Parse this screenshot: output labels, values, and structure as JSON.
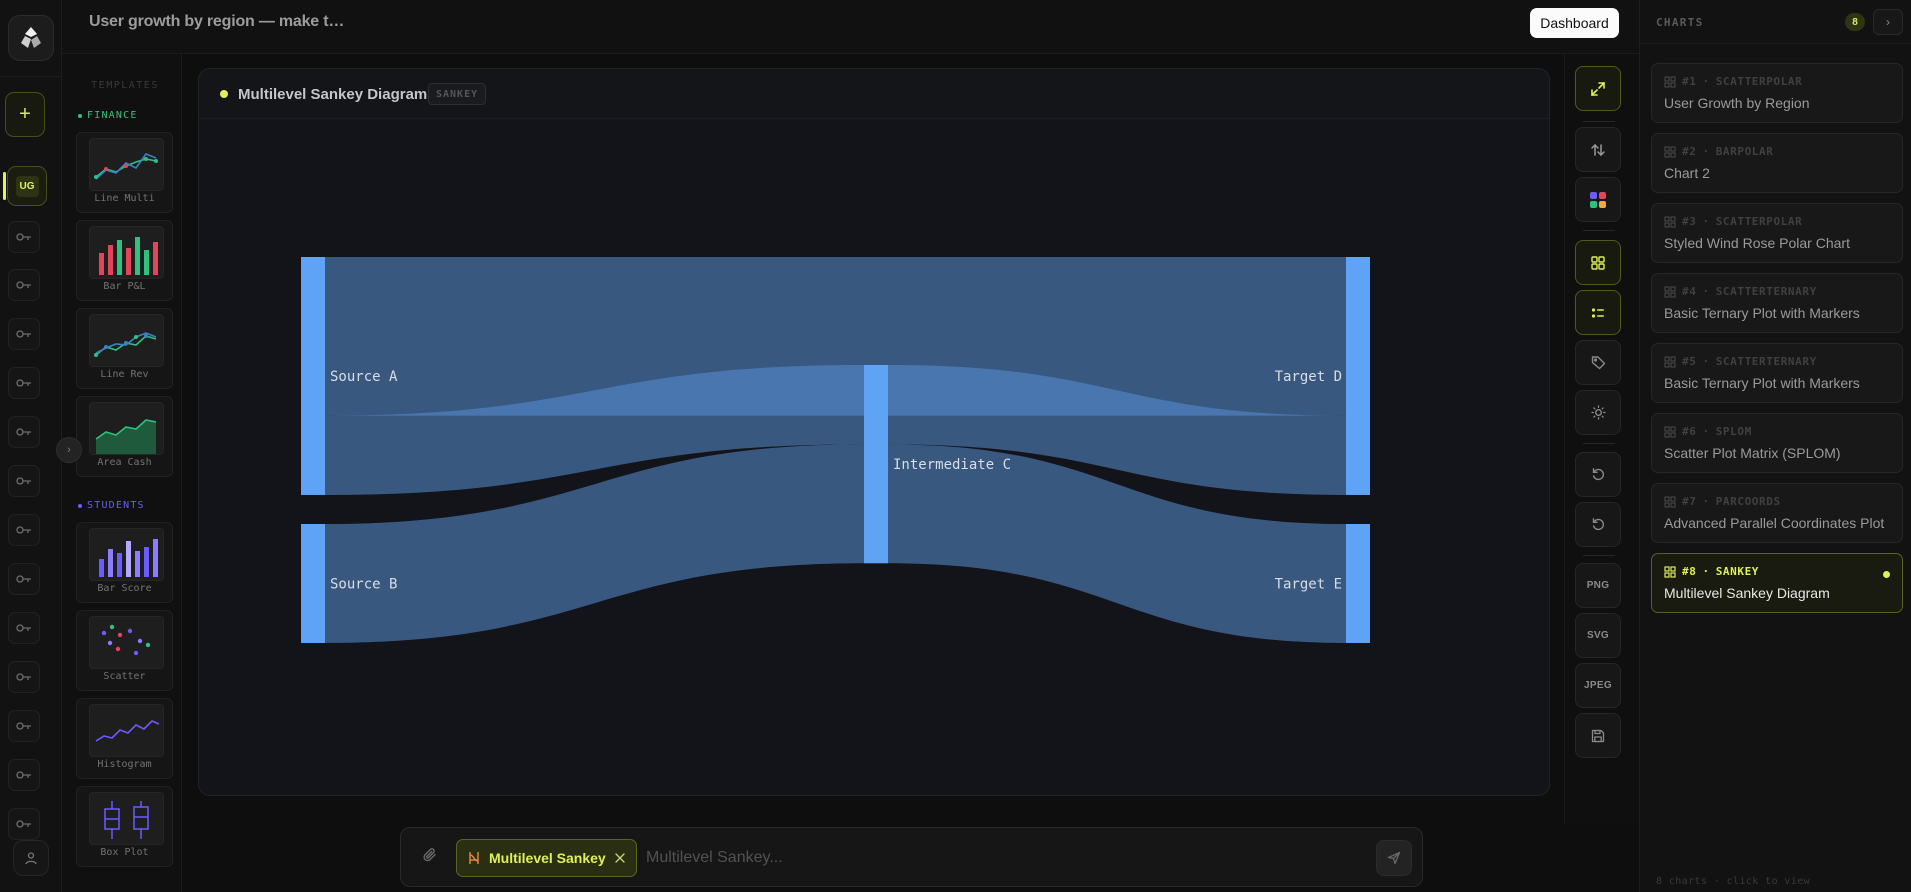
{
  "app": {
    "logo_icon": "app-logo-icon"
  },
  "rail": {
    "new_label": "+",
    "active_item_label": "UG",
    "item_icon": "key-icon",
    "user_icon": "user-icon"
  },
  "topbar": {
    "title": "User growth by region — make t…",
    "dashboard_label": "Dashboard"
  },
  "templates": {
    "header": "TEMPLATES",
    "collapse_icon": "›",
    "categories": [
      {
        "name": "FINANCE",
        "color": "#2ec27e",
        "items": [
          {
            "label": "Line Multi"
          },
          {
            "label": "Bar P&L"
          },
          {
            "label": "Line Rev"
          },
          {
            "label": "Area Cash"
          }
        ]
      },
      {
        "name": "STUDENTS",
        "color": "#6a5cff",
        "items": [
          {
            "label": "Bar Score"
          },
          {
            "label": "Scatter"
          },
          {
            "label": "Histogram"
          },
          {
            "label": "Box Plot"
          }
        ]
      }
    ]
  },
  "card": {
    "title": "Multilevel Sankey Diagram",
    "badge": "SANKEY"
  },
  "chart_data": {
    "type": "sankey",
    "nodes": [
      "Source A",
      "Source B",
      "Intermediate C",
      "Target D",
      "Target E"
    ],
    "links": [
      {
        "source": "Source A",
        "target": "Target D",
        "value": 8
      },
      {
        "source": "Source A",
        "target": "Intermediate C",
        "value": 4
      },
      {
        "source": "Source B",
        "target": "Intermediate C",
        "value": 6
      },
      {
        "source": "Intermediate C",
        "target": "Target D",
        "value": 4
      },
      {
        "source": "Intermediate C",
        "target": "Target E",
        "value": 6
      }
    ],
    "node_color": "#5fa3f5",
    "link_color": "#5a8fd6"
  },
  "toolbar": {
    "expand_icon": "expand-icon",
    "swap_icon": "swap-icon",
    "palette_icon": "palette-icon",
    "grid_icon": "grid-icon",
    "list_icon": "list-icon",
    "tag_icon": "tag-icon",
    "theme_icon": "sun-icon",
    "undo_icon": "undo-icon",
    "redo_icon": "redo-icon",
    "png_label": "PNG",
    "svg_label": "SVG",
    "jpeg_label": "JPEG",
    "save_icon": "save-icon"
  },
  "charts_panel": {
    "title": "CHARTS",
    "count": "8",
    "next_icon": "›",
    "items": [
      {
        "num": "#1",
        "type": "SCATTERPOLAR",
        "title": "User Growth by Region"
      },
      {
        "num": "#2",
        "type": "BARPOLAR",
        "title": "Chart 2"
      },
      {
        "num": "#3",
        "type": "SCATTERPOLAR",
        "title": "Styled Wind Rose Polar Chart"
      },
      {
        "num": "#4",
        "type": "SCATTERTERNARY",
        "title": "Basic Ternary Plot with Markers"
      },
      {
        "num": "#5",
        "type": "SCATTERTERNARY",
        "title": "Basic Ternary Plot with Markers"
      },
      {
        "num": "#6",
        "type": "SPLOM",
        "title": "Scatter Plot Matrix (SPLOM)"
      },
      {
        "num": "#7",
        "type": "PARCOORDS",
        "title": "Advanced Parallel Coordinates Plot"
      },
      {
        "num": "#8",
        "type": "SANKEY",
        "title": "Multilevel Sankey Diagram"
      }
    ],
    "active_index": 7,
    "footer": "8 charts · click to view"
  },
  "composer": {
    "chip_label": "Multilevel Sankey",
    "placeholder": "Multilevel Sankey...",
    "value": ""
  },
  "colors": {
    "accent": "#dff058",
    "finance": "#2ec27e",
    "students": "#6a5cff"
  }
}
